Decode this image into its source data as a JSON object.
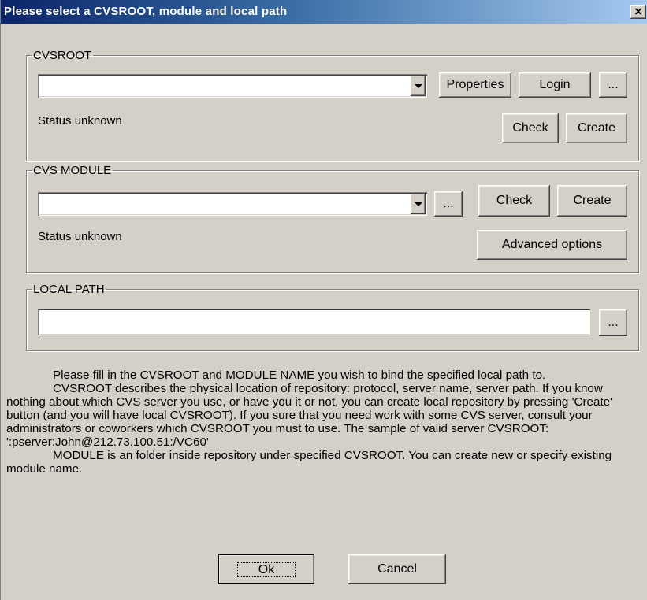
{
  "window": {
    "title": "Please select a CVSROOT, module and local path",
    "close_label": "×"
  },
  "cvsroot": {
    "legend": "CVSROOT",
    "combo_value": "",
    "properties_label": "Properties",
    "login_label": "Login",
    "browse_label": "...",
    "status": "Status unknown",
    "check_label": "Check",
    "create_label": "Create"
  },
  "module": {
    "legend": "CVS MODULE",
    "combo_value": "",
    "browse_label": "...",
    "check_label": "Check",
    "create_label": "Create",
    "status": "Status unknown",
    "advanced_label": "Advanced options"
  },
  "local_path": {
    "legend": "LOCAL PATH",
    "value": "",
    "browse_label": "..."
  },
  "help": {
    "p1": "Please fill in the CVSROOT and MODULE NAME you wish to bind the specified local path to.",
    "p2": "CVSROOT describes the physical location of repository: protocol, server name, server path. If you know nothing about which CVS server you use, or have you it or not, you can create local repository by pressing 'Create' button (and you will have local CVSROOT). If you sure that you need work with some CVS server, consult your administrators or coworkers which CVSROOT you must to use. The sample of valid server CVSROOT: ':pserver:John@212.73.100.51:/VC60'",
    "p3": "MODULE is an folder inside repository under specified CVSROOT. You can create new or specify existing module name."
  },
  "footer": {
    "ok_label": "Ok",
    "cancel_label": "Cancel"
  }
}
